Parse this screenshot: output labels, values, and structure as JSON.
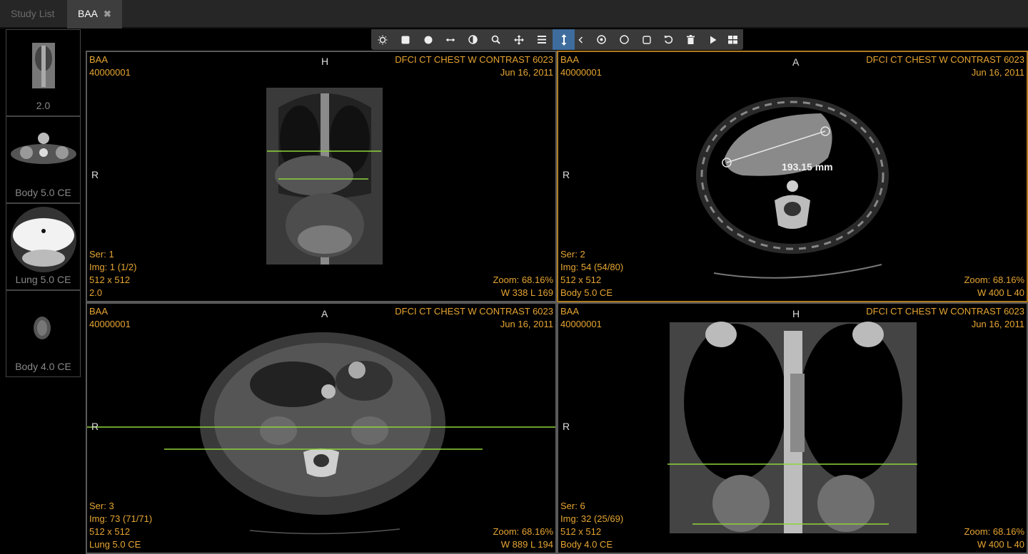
{
  "tabs": {
    "study_list": "Study List",
    "active": "BAA",
    "close_glyph": "✖"
  },
  "thumbnails": [
    {
      "label": "2.0"
    },
    {
      "label": "Body 5.0 CE"
    },
    {
      "label": "Lung 5.0 CE"
    },
    {
      "label": "Body 4.0 CE"
    }
  ],
  "toolbar": {
    "tools": [
      {
        "icon": "brightness-icon"
      },
      {
        "icon": "square-fill-icon"
      },
      {
        "icon": "circle-fill-icon"
      },
      {
        "icon": "length-icon"
      },
      {
        "icon": "contrast-icon"
      },
      {
        "icon": "zoom-icon"
      },
      {
        "icon": "pan-icon"
      },
      {
        "icon": "menu-icon"
      },
      {
        "icon": "stack-scroll-icon",
        "active": true
      },
      {
        "icon": "chevron-left-icon"
      },
      {
        "icon": "target-icon"
      },
      {
        "icon": "circle-outline-icon"
      },
      {
        "icon": "rectangle-icon"
      },
      {
        "icon": "reset-icon"
      },
      {
        "icon": "trash-icon"
      },
      {
        "icon": "play-icon"
      },
      {
        "icon": "layout-icon"
      }
    ]
  },
  "viewports": [
    {
      "patient": "BAA",
      "id": "40000001",
      "study": "DFCI CT CHEST W CONTRAST 6023",
      "date": "Jun 16, 2011",
      "top_orient": "H",
      "left_orient": "R",
      "ser": "Ser: 1",
      "img": "Img: 1 (1/2)",
      "size": "512 x 512",
      "desc": "2.0",
      "zoom": "Zoom: 68.16%",
      "wl": "W 338 L 169"
    },
    {
      "patient": "BAA",
      "id": "40000001",
      "study": "DFCI CT CHEST W CONTRAST 6023",
      "date": "Jun 16, 2011",
      "top_orient": "A",
      "left_orient": "R",
      "ser": "Ser: 2",
      "img": "Img: 54 (54/80)",
      "size": "512 x 512",
      "desc": "Body 5.0 CE",
      "zoom": "Zoom: 68.16%",
      "wl": "W 400 L 40",
      "measurement": "193.15 mm"
    },
    {
      "patient": "BAA",
      "id": "40000001",
      "study": "DFCI CT CHEST W CONTRAST 6023",
      "date": "Jun 16, 2011",
      "top_orient": "A",
      "left_orient": "R",
      "ser": "Ser: 3",
      "img": "Img: 73 (71/71)",
      "size": "512 x 512",
      "desc": "Lung 5.0 CE",
      "zoom": "Zoom: 68.16%",
      "wl": "W 889 L 194"
    },
    {
      "patient": "BAA",
      "id": "40000001",
      "study": "DFCI CT CHEST W CONTRAST 6023",
      "date": "Jun 16, 2011",
      "top_orient": "H",
      "left_orient": "R",
      "ser": "Ser: 6",
      "img": "Img: 32 (25/69)",
      "size": "512 x 512",
      "desc": "Body 4.0 CE",
      "zoom": "Zoom: 68.16%",
      "wl": "W 400 L 40"
    }
  ],
  "colors": {
    "overlay_text": "#e6a533",
    "reference_line": "#8fd43a",
    "active_border": "#b07a1e",
    "active_tool": "#3e6c9c"
  }
}
